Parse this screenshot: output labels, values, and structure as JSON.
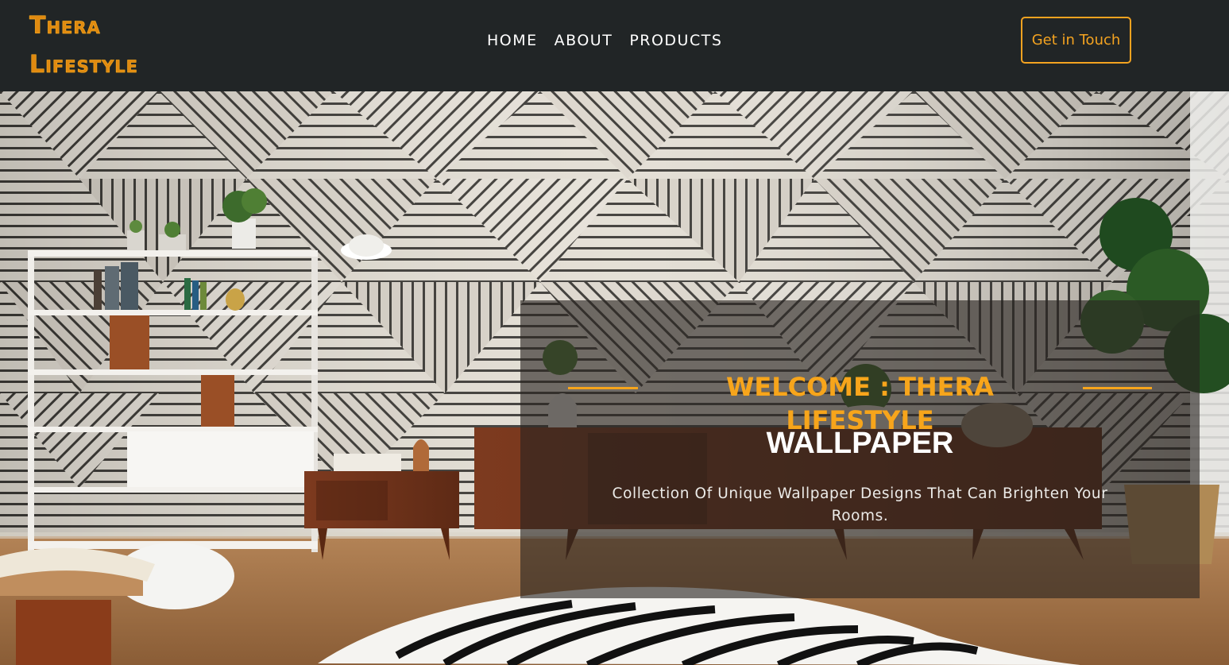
{
  "header": {
    "logo_line1": "Thera",
    "logo_line2": "Lifestyle",
    "nav": [
      "HOME",
      "ABOUT",
      "PRODUCTS"
    ],
    "cta_label": "Get in Touch"
  },
  "hero": {
    "welcome": "WELCOME : THERA LIFESTYLE",
    "title": "WALLPAPER",
    "description": "Collection Of Unique Wallpaper Designs That Can Brighten Your Rooms."
  },
  "colors": {
    "accent": "#f7a51b",
    "header_bg": "#212526",
    "text_light": "#ffffff"
  }
}
